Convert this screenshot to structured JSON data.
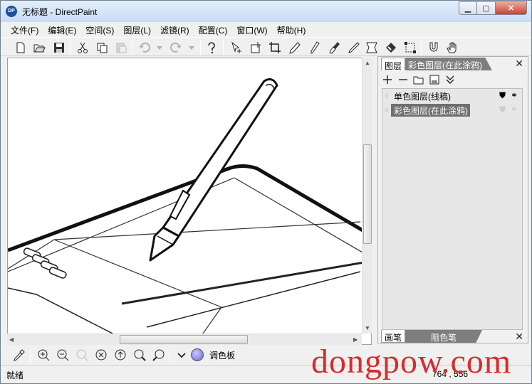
{
  "window": {
    "title": "无标题 - DirectPaint",
    "app_icon_label": "DP",
    "buttons": [
      "minimize",
      "maximize",
      "close"
    ]
  },
  "menubar": {
    "items": [
      "文件(F)",
      "编辑(E)",
      "空间(S)",
      "图层(L)",
      "滤镜(R)",
      "配置(C)",
      "窗口(W)",
      "帮助(H)"
    ]
  },
  "toolbar": {
    "icons": [
      "new-file-icon",
      "open-folder-icon",
      "save-icon",
      "cut-icon",
      "copy-icon",
      "paste-icon",
      "undo-icon",
      "dropdown-icon",
      "redo-icon",
      "dropdown-icon",
      "help-icon",
      "select-move-icon",
      "add-canvas-icon",
      "crop-icon",
      "pencil-icon",
      "pen-icon",
      "brush-icon",
      "line-pen-icon",
      "transform-icon",
      "eraser-icon",
      "selection-icon",
      "magnet-icon",
      "hand-icon"
    ]
  },
  "layers_panel": {
    "tabs": [
      "图层",
      "彩色图层(在此涂鸦)"
    ],
    "active_tab": "图层",
    "layers": [
      {
        "name": "单色图层(线稿)",
        "selected": false
      },
      {
        "name": "彩色图层(在此涂鸦)",
        "selected": true
      }
    ],
    "bottom_tabs": [
      "画笔",
      "阻色笔"
    ]
  },
  "zoombar": {
    "icons": [
      "eyedropper-icon",
      "zoom-in-icon",
      "zoom-out-icon",
      "zoom-fit-icon",
      "zoom-reset-icon",
      "rotate-icon",
      "zoom-custom-icon",
      "zoom-area-icon",
      "chevron-down-icon"
    ],
    "palette_label": "调色板",
    "current_color": "#7a74e0"
  },
  "status": {
    "text": "就绪",
    "coords": "764 , 556"
  },
  "watermark": "dongpow.com"
}
